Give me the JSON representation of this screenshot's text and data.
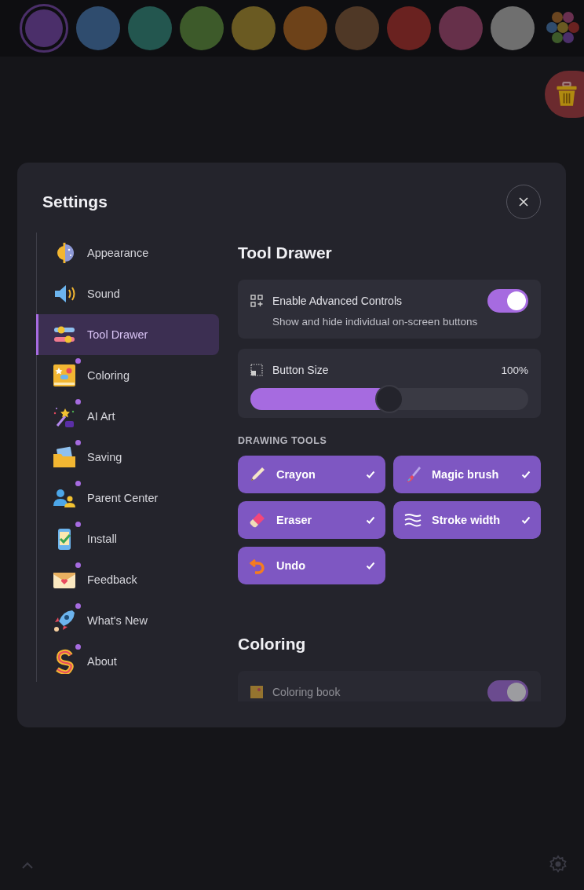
{
  "swatches": [
    {
      "color": "#4b2f6a",
      "selected": true
    },
    {
      "color": "#2f4c6e",
      "selected": false
    },
    {
      "color": "#23564f",
      "selected": false
    },
    {
      "color": "#3d5a2a",
      "selected": false
    },
    {
      "color": "#6a5a22",
      "selected": false
    },
    {
      "color": "#6d4219",
      "selected": false
    },
    {
      "color": "#4f3826",
      "selected": false
    },
    {
      "color": "#6a2220",
      "selected": false
    },
    {
      "color": "#66304a",
      "selected": false
    },
    {
      "color": "#6f6f6f",
      "selected": false
    }
  ],
  "dialog": {
    "title": "Settings"
  },
  "sidebar": {
    "items": [
      {
        "label": "Appearance",
        "selected": false,
        "badge": false
      },
      {
        "label": "Sound",
        "selected": false,
        "badge": false
      },
      {
        "label": "Tool Drawer",
        "selected": true,
        "badge": false
      },
      {
        "label": "Coloring",
        "selected": false,
        "badge": true
      },
      {
        "label": "AI Art",
        "selected": false,
        "badge": true
      },
      {
        "label": "Saving",
        "selected": false,
        "badge": true
      },
      {
        "label": "Parent Center",
        "selected": false,
        "badge": true
      },
      {
        "label": "Install",
        "selected": false,
        "badge": true
      },
      {
        "label": "Feedback",
        "selected": false,
        "badge": true
      },
      {
        "label": "What's New",
        "selected": false,
        "badge": true
      },
      {
        "label": "About",
        "selected": false,
        "badge": true
      }
    ]
  },
  "tool_drawer": {
    "title": "Tool Drawer",
    "advanced": {
      "label": "Enable Advanced Controls",
      "description": "Show and hide individual on-screen buttons",
      "on": true
    },
    "button_size": {
      "label": "Button Size",
      "reading": "100%",
      "level": 0.5
    },
    "section_label": "DRAWING TOOLS",
    "tools": [
      {
        "label": "Crayon",
        "checked": true
      },
      {
        "label": "Magic brush",
        "checked": true
      },
      {
        "label": "Eraser",
        "checked": true
      },
      {
        "label": "Stroke width",
        "checked": true
      },
      {
        "label": "Undo",
        "checked": true
      }
    ]
  },
  "coloring": {
    "title": "Coloring",
    "coloring_book": {
      "label": "Coloring book",
      "on": true
    }
  }
}
